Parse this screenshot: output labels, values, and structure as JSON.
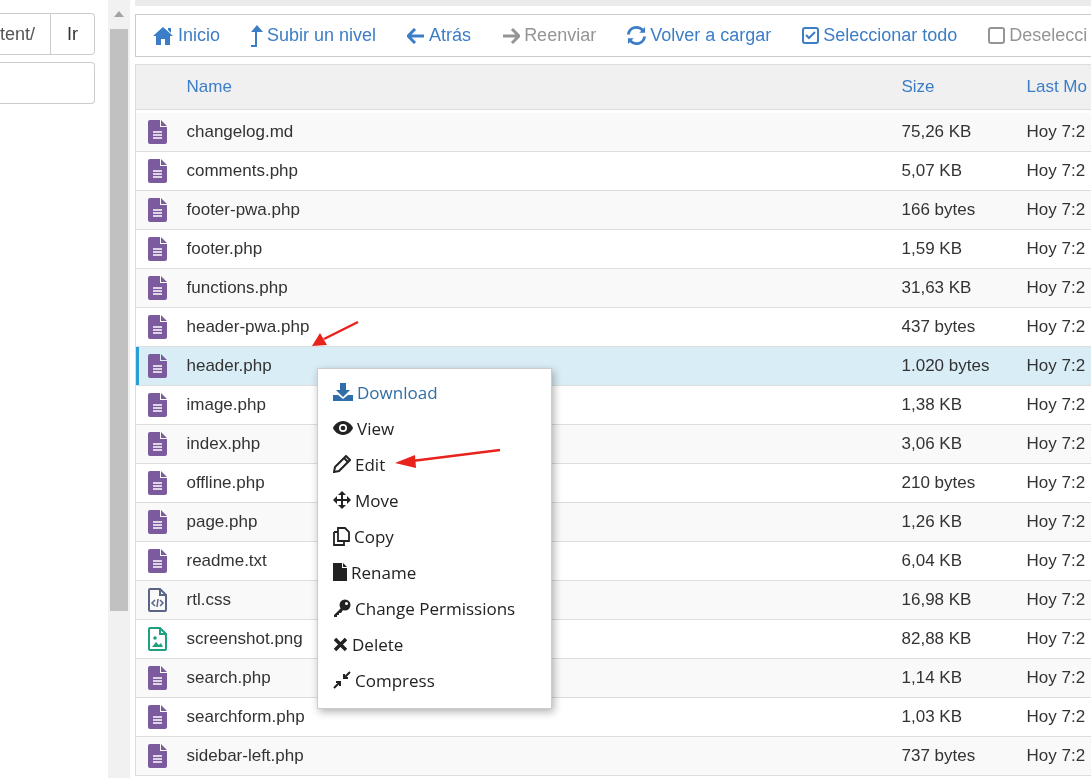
{
  "sidebar": {
    "path_field": {
      "value": "tent/"
    },
    "go_button": "Ir"
  },
  "toolbar": [
    {
      "kind": "home",
      "label": "Inicio",
      "disabled": false
    },
    {
      "kind": "up",
      "label": "Subir un nivel",
      "disabled": false
    },
    {
      "kind": "back",
      "label": "Atrás",
      "disabled": false
    },
    {
      "kind": "forward",
      "label": "Reenviar",
      "disabled": true
    },
    {
      "kind": "reload",
      "label": "Volver a cargar",
      "disabled": false
    },
    {
      "kind": "select-all",
      "label": "Seleccionar todo",
      "disabled": false
    },
    {
      "kind": "deselect-all",
      "label": "Deselecci",
      "disabled": true
    }
  ],
  "table": {
    "columns": [
      "Name",
      "Size",
      "Last Mo"
    ],
    "rows": [
      {
        "kind": "text",
        "name": "changelog.md",
        "size": "75,26 KB",
        "modified": "Hoy 7:2",
        "selected": false
      },
      {
        "kind": "text",
        "name": "comments.php",
        "size": "5,07 KB",
        "modified": "Hoy 7:2",
        "selected": false
      },
      {
        "kind": "text",
        "name": "footer-pwa.php",
        "size": "166 bytes",
        "modified": "Hoy 7:2",
        "selected": false
      },
      {
        "kind": "text",
        "name": "footer.php",
        "size": "1,59 KB",
        "modified": "Hoy 7:2",
        "selected": false
      },
      {
        "kind": "text",
        "name": "functions.php",
        "size": "31,63 KB",
        "modified": "Hoy 7:2",
        "selected": false
      },
      {
        "kind": "text",
        "name": "header-pwa.php",
        "size": "437 bytes",
        "modified": "Hoy 7:2",
        "selected": false
      },
      {
        "kind": "text",
        "name": "header.php",
        "size": "1.020 bytes",
        "modified": "Hoy 7:2",
        "selected": true
      },
      {
        "kind": "text",
        "name": "image.php",
        "size": "1,38 KB",
        "modified": "Hoy 7:2",
        "selected": false
      },
      {
        "kind": "text",
        "name": "index.php",
        "size": "3,06 KB",
        "modified": "Hoy 7:2",
        "selected": false
      },
      {
        "kind": "text",
        "name": "offline.php",
        "size": "210 bytes",
        "modified": "Hoy 7:2",
        "selected": false
      },
      {
        "kind": "text",
        "name": "page.php",
        "size": "1,26 KB",
        "modified": "Hoy 7:2",
        "selected": false
      },
      {
        "kind": "text",
        "name": "readme.txt",
        "size": "6,04 KB",
        "modified": "Hoy 7:2",
        "selected": false
      },
      {
        "kind": "code",
        "name": "rtl.css",
        "size": "16,98 KB",
        "modified": "Hoy 7:2",
        "selected": false
      },
      {
        "kind": "image",
        "name": "screenshot.png",
        "size": "82,88 KB",
        "modified": "Hoy 7:2",
        "selected": false
      },
      {
        "kind": "text",
        "name": "search.php",
        "size": "1,14 KB",
        "modified": "Hoy 7:2",
        "selected": false
      },
      {
        "kind": "text",
        "name": "searchform.php",
        "size": "1,03 KB",
        "modified": "Hoy 7:2",
        "selected": false
      },
      {
        "kind": "text",
        "name": "sidebar-left.php",
        "size": "737 bytes",
        "modified": "Hoy 7:2",
        "selected": false
      }
    ]
  },
  "context_menu": [
    {
      "kind": "download",
      "label": "Download",
      "selected": true
    },
    {
      "kind": "view",
      "label": "View",
      "selected": false
    },
    {
      "kind": "edit",
      "label": "Edit",
      "selected": false
    },
    {
      "kind": "move",
      "label": "Move",
      "selected": false
    },
    {
      "kind": "copy",
      "label": "Copy",
      "selected": false
    },
    {
      "kind": "rename",
      "label": "Rename",
      "selected": false
    },
    {
      "kind": "permissions",
      "label": "Change Permissions",
      "selected": false
    },
    {
      "kind": "delete",
      "label": "Delete",
      "selected": false
    },
    {
      "kind": "compress",
      "label": "Compress",
      "selected": false
    }
  ]
}
